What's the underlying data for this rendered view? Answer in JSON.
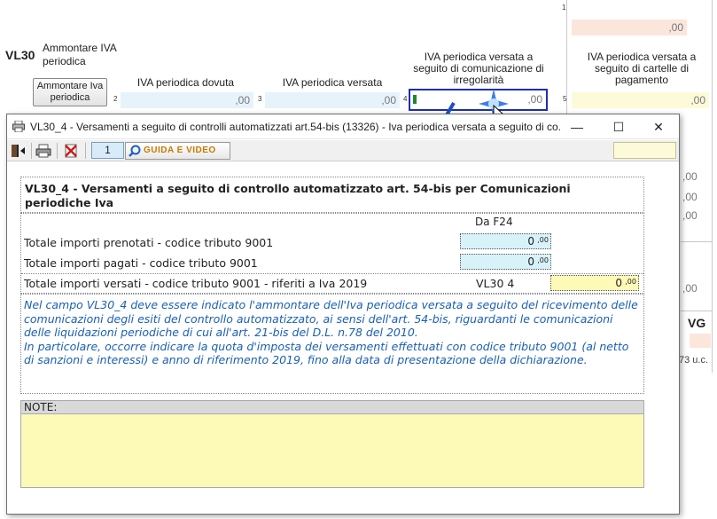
{
  "background": {
    "code": "VL30",
    "description": "Ammontare IVA periodica",
    "button_label": "Ammontare Iva periodica",
    "fields": [
      {
        "num": "1",
        "value": ",00"
      },
      {
        "num": "2",
        "label": "IVA periodica dovuta",
        "value": ",00"
      },
      {
        "num": "3",
        "label": "IVA periodica versata",
        "value": ",00"
      },
      {
        "num": "4",
        "label": "IVA periodica versata a seguito di comunicazione di irregolarità",
        "value": ",00"
      },
      {
        "num": "5",
        "label": "IVA periodica versata a seguito di cartelle di pagamento",
        "value": ",00"
      }
    ],
    "side_values": [
      ",00",
      ",00",
      ",00",
      ",00"
    ],
    "vg_label": "VG",
    "uc_text": "73 u.c."
  },
  "dialog": {
    "title": "VL30_4 - Versamenti a seguito di controlli automatizzati art.54-bis (13326) - Iva periodica versata a seguito di co...",
    "controls": {
      "minimize": "—",
      "maximize": "☐",
      "close": "✕"
    },
    "toolbar": {
      "page_number": "1",
      "guide_label": "GUIDA E VIDEO"
    },
    "heading": "VL30_4 - Versamenti a seguito di controllo automatizzato art. 54-bis per Comunicazioni periodiche Iva",
    "column_header": "Da F24",
    "rows": [
      {
        "label": "Totale importi prenotati - codice tributo 9001",
        "value": "0",
        "decimals": ",00"
      },
      {
        "label": "Totale importi pagati - codice tributo 9001",
        "value": "0",
        "decimals": ",00"
      },
      {
        "label": "Totale importi versati - codice tributo 9001 - riferiti a Iva 2019",
        "ref": "VL30  4",
        "value": "0",
        "decimals": ",00"
      }
    ],
    "info_text": "Nel campo VL30_4 deve essere indicato l'ammontare dell'Iva periodica versata a seguito del ricevimento delle comunicazioni degli esiti del controllo automatizzato, ai sensi dell'art. 54-bis, riguardanti le comunicazioni delle liquidazioni periodiche di cui all'art. 21-bis del D.L. n.78 del 2010.\nIn particolare, occorre indicare la quota d'imposta dei versamenti effettuati con codice tributo 9001 (al netto di sanzioni e interessi) e anno di riferimento 2019, fino alla data di presentazione della dichiarazione.",
    "notes_label": "NOTE:",
    "notes_value": ""
  },
  "colors": {
    "info_text": "#1a5fb4",
    "calc_field": "#d7f2f9",
    "input_field": "#fdfab8",
    "active_border": "#1c2fb5",
    "guide_text": "#c87a00"
  }
}
